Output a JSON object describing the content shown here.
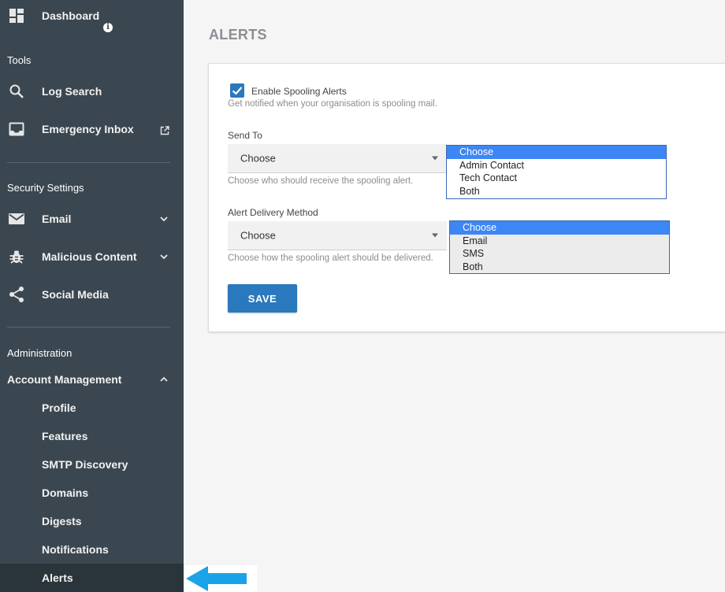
{
  "sidebar": {
    "dashboard": {
      "label": "Dashboard",
      "icon": "dashboard-icon",
      "badge_icon": "info-icon"
    },
    "tools_header": "Tools",
    "tools": [
      {
        "label": "Log Search",
        "icon": "search-icon"
      },
      {
        "label": "Emergency Inbox",
        "icon": "inbox-icon",
        "trailing_icon": "external-link-icon"
      }
    ],
    "security_header": "Security Settings",
    "security": [
      {
        "label": "Email",
        "icon": "mail-icon",
        "expand_icon": "chevron-down-icon"
      },
      {
        "label": "Malicious Content",
        "icon": "bug-icon",
        "expand_icon": "chevron-down-icon"
      },
      {
        "label": "Social Media",
        "icon": "share-icon"
      }
    ],
    "admin_header": "Administration",
    "account_management": {
      "label": "Account Management",
      "expand_icon": "chevron-up-icon"
    },
    "account_items": [
      {
        "label": "Profile"
      },
      {
        "label": "Features"
      },
      {
        "label": "SMTP Discovery"
      },
      {
        "label": "Domains"
      },
      {
        "label": "Digests"
      },
      {
        "label": "Notifications"
      },
      {
        "label": "Alerts"
      }
    ]
  },
  "main": {
    "title": "ALERTS",
    "enable_label": "Enable Spooling Alerts",
    "enable_checked": true,
    "enable_hint": "Get notified when your organisation is spooling mail.",
    "send_to": {
      "label": "Send To",
      "value": "Choose",
      "hint": "Choose who should receive the spooling alert.",
      "options": [
        "Choose",
        "Admin Contact",
        "Tech Contact",
        "Both"
      ]
    },
    "delivery": {
      "label": "Alert Delivery Method",
      "value": "Choose",
      "hint": "Choose how the spooling alert should be delivered.",
      "options": [
        "Choose",
        "Email",
        "SMS",
        "Both"
      ]
    },
    "save_label": "SAVE"
  },
  "annotation": {
    "arrow_color": "#1aa3e8"
  },
  "colors": {
    "sidebar_bg": "#3b4750",
    "accent": "#2a78bd",
    "highlight": "#3d86f5"
  }
}
